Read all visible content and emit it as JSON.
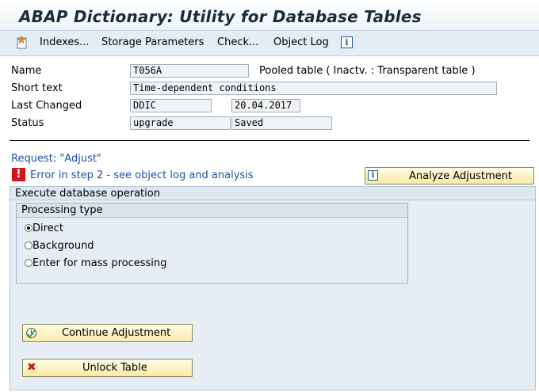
{
  "title": "ABAP Dictionary: Utility for Database Tables",
  "toolbar": {
    "create_icon": "create-object-icon",
    "indexes": "Indexes...",
    "storage_parameters": "Storage Parameters",
    "check": "Check...",
    "object_log": "Object Log",
    "info_icon": "info-icon"
  },
  "form": {
    "name_label": "Name",
    "name_value": "T056A",
    "table_type": "Pooled table ( Inactv. : Transparent table )",
    "short_text_label": "Short text",
    "short_text_value": "Time-dependent conditions",
    "last_changed_label": "Last Changed",
    "last_changed_user": "DDIC",
    "last_changed_date": "20.04.2017",
    "status_label": "Status",
    "status_value1": "upgrade",
    "status_value2": "Saved"
  },
  "request": {
    "text": "Request: \"Adjust\"",
    "error_icon": "error-icon",
    "error_text": "Error in step 2 - see object log and analysis"
  },
  "analyze_button": "Analyze Adjustment",
  "panel": {
    "title": "Execute database operation",
    "group_title": "Processing type",
    "options": [
      {
        "label": "Direct",
        "selected": true
      },
      {
        "label": "Background",
        "selected": false
      },
      {
        "label": "Enter for mass processing",
        "selected": false
      }
    ]
  },
  "buttons": {
    "continue": "Continue Adjustment",
    "unlock": "Unlock Table"
  }
}
